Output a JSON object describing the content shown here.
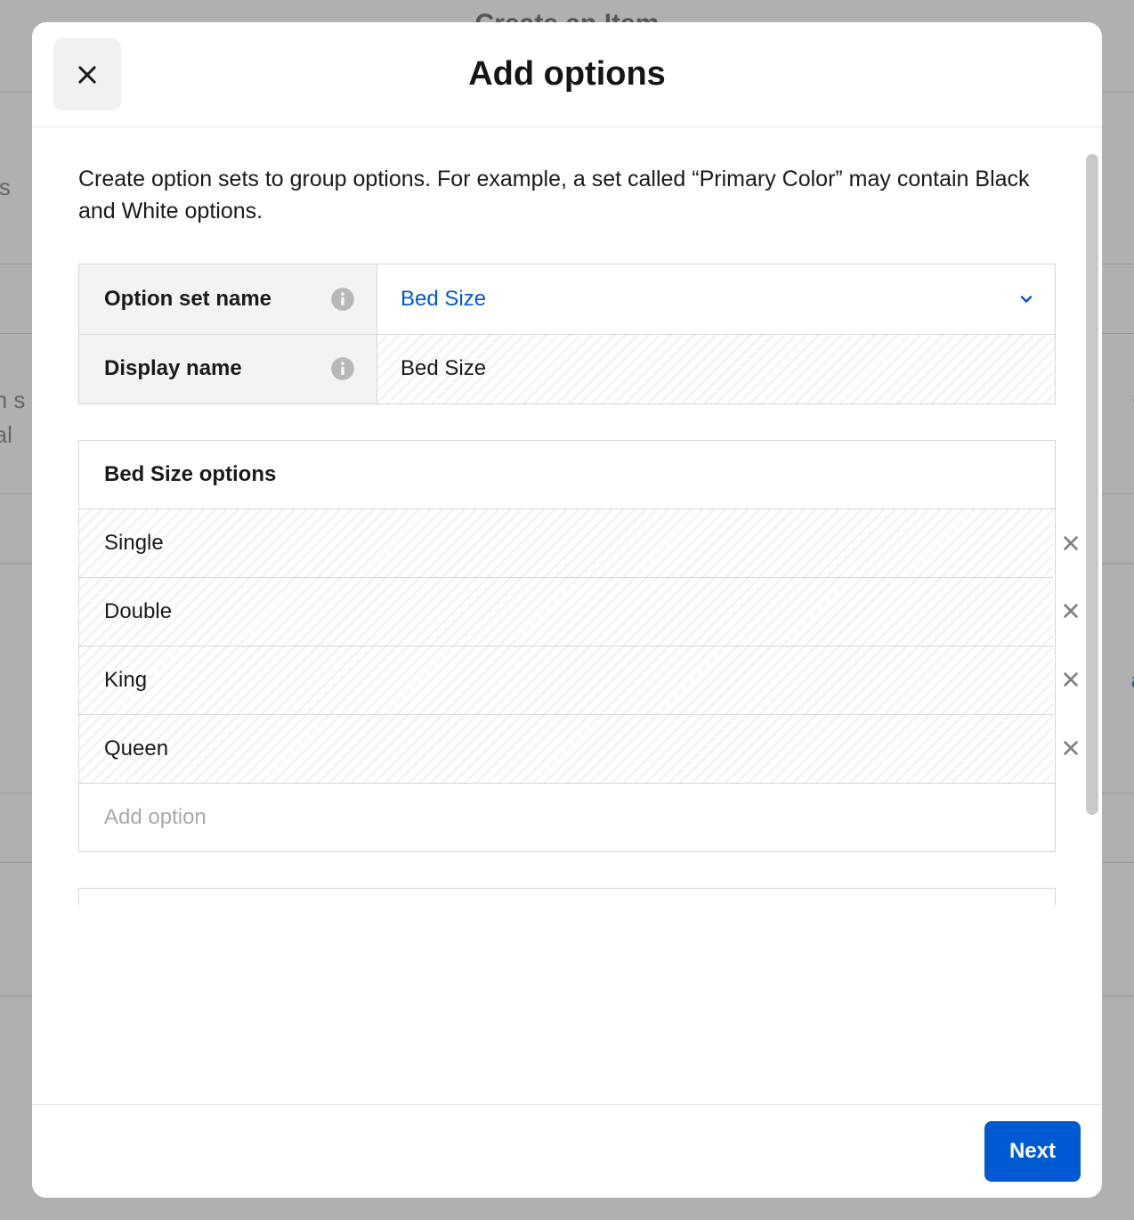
{
  "backdrop": {
    "title": "Create an Item",
    "left1": "ons",
    "left2a": "om s",
    "left2b": "mal",
    "right1": "at",
    "right2": "at"
  },
  "modal": {
    "title": "Add options",
    "description": "Create option sets to group options. For example, a set called “Primary Color” may contain Black and White options.",
    "config": {
      "option_set_name_label": "Option set name",
      "option_set_name_value": "Bed Size",
      "display_name_label": "Display name",
      "display_name_value": "Bed Size"
    },
    "options_section": {
      "header": "Bed Size options",
      "items": [
        "Single",
        "Double",
        "King",
        "Queen"
      ],
      "add_placeholder": "Add option"
    },
    "footer": {
      "next_label": "Next"
    }
  }
}
